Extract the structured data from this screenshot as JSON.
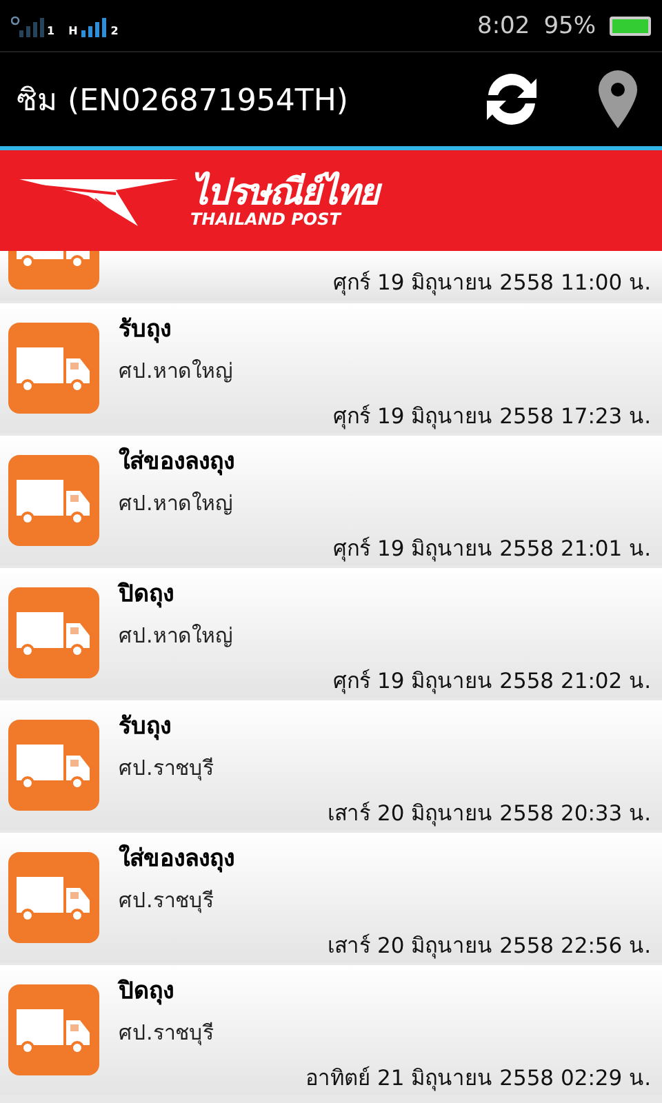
{
  "status_bar": {
    "sim1_label": "1",
    "sim2_network": "H",
    "sim2_label": "2",
    "time": "8:02",
    "battery": "95%"
  },
  "app_bar": {
    "title": "ซิม (EN026871954TH)"
  },
  "banner": {
    "logo_thai": "ไปรษณีย์ไทย",
    "logo_english": "THAILAND POST"
  },
  "events": [
    {
      "kind": "partial",
      "date": "ศุกร์ 19 มิถุนายน 2558 11:00 น."
    },
    {
      "kind": "full",
      "status": "รับถุง",
      "office": "ศป.หาดใหญ่",
      "date": "ศุกร์ 19 มิถุนายน 2558 17:23 น."
    },
    {
      "kind": "full",
      "status": "ใส่ของลงถุง",
      "office": "ศป.หาดใหญ่",
      "date": "ศุกร์ 19 มิถุนายน 2558 21:01 น."
    },
    {
      "kind": "full",
      "status": "ปิดถุง",
      "office": "ศป.หาดใหญ่",
      "date": "ศุกร์ 19 มิถุนายน 2558 21:02 น."
    },
    {
      "kind": "full",
      "status": "รับถุง",
      "office": "ศป.ราชบุรี",
      "date": "เสาร์ 20 มิถุนายน 2558 20:33 น."
    },
    {
      "kind": "full",
      "status": "ใส่ของลงถุง",
      "office": "ศป.ราชบุรี",
      "date": "เสาร์ 20 มิถุนายน 2558 22:56 น."
    },
    {
      "kind": "full",
      "status": "ปิดถุง",
      "office": "ศป.ราชบุรี",
      "date": "อาทิตย์ 21 มิถุนายน 2558 02:29 น."
    }
  ]
}
